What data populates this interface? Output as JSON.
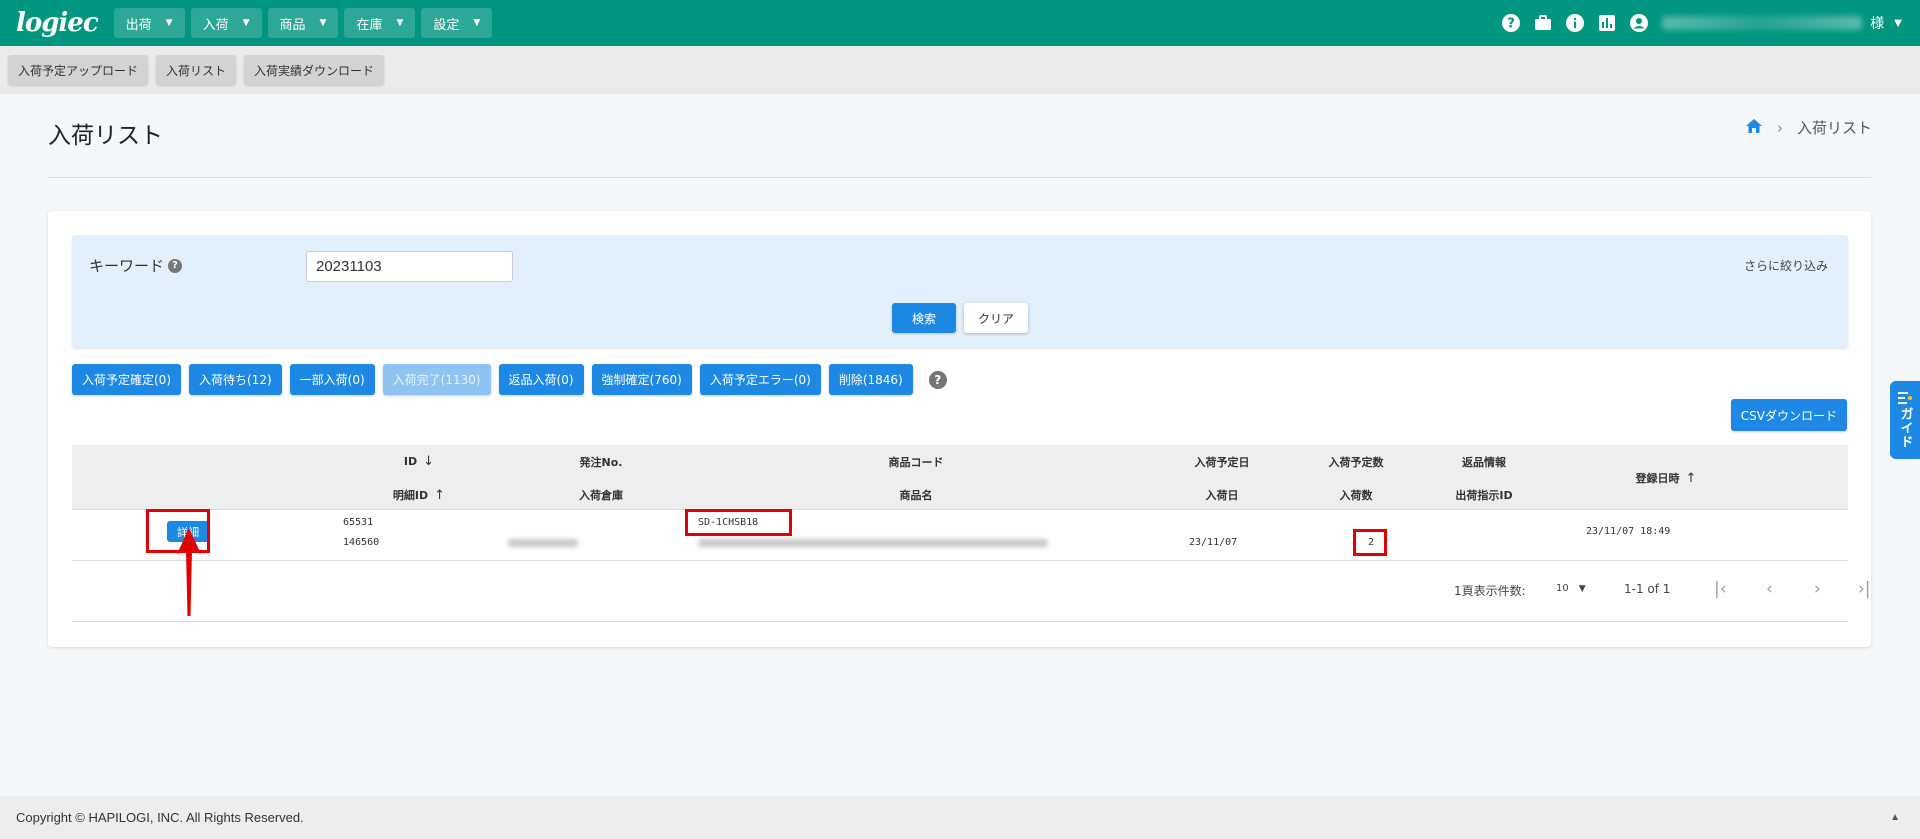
{
  "topbar": {
    "logo": "logiec",
    "logo_sub": "",
    "nav": [
      {
        "label": "出荷"
      },
      {
        "label": "入荷"
      },
      {
        "label": "商品"
      },
      {
        "label": "在庫"
      },
      {
        "label": "設定"
      }
    ],
    "user_suffix": "様",
    "icons": [
      "help-icon",
      "briefcase-icon",
      "info-icon",
      "chart-icon",
      "account-icon"
    ],
    "color": "#00957f"
  },
  "subbar": {
    "buttons": [
      {
        "label": "入荷予定アップロード"
      },
      {
        "label": "入荷リスト"
      },
      {
        "label": "入荷実績ダウンロード"
      }
    ]
  },
  "page": {
    "title": "入荷リスト",
    "breadcrumb_current": "入荷リスト"
  },
  "search": {
    "keyword_label": "キーワード",
    "keyword_value": "20231103",
    "narrow_label": "さらに絞り込み",
    "search_label": "検索",
    "clear_label": "クリア"
  },
  "filters": [
    {
      "label": "入荷予定確定(0)",
      "disabled": false
    },
    {
      "label": "入荷待ち(12)",
      "disabled": false
    },
    {
      "label": "一部入荷(0)",
      "disabled": false
    },
    {
      "label": "入荷完了(1130)",
      "disabled": true
    },
    {
      "label": "返品入荷(0)",
      "disabled": false
    },
    {
      "label": "強制確定(760)",
      "disabled": false
    },
    {
      "label": "入荷予定エラー(0)",
      "disabled": false
    },
    {
      "label": "削除(1846)",
      "disabled": false
    }
  ],
  "csv_label": "CSVダウンロード",
  "table": {
    "headers": {
      "id": "ID",
      "detail_id": "明細ID",
      "order_no": "発注No.",
      "warehouse": "入荷倉庫",
      "product_code": "商品コード",
      "product_name": "商品名",
      "scheduled_date": "入荷予定日",
      "arrival_date": "入荷日",
      "scheduled_qty": "入荷予定数",
      "arrival_qty": "入荷数",
      "return_info": "返品情報",
      "shipping_id": "出荷指示ID",
      "registered_at": "登録日時"
    },
    "row": {
      "detail_button": "詳細",
      "id": "65531",
      "detail_id": "146560",
      "product_code": "SD-1CHSB18",
      "arrival_date": "23/11/07",
      "arrival_qty": "2",
      "registered_at": "23/11/07 18:49"
    }
  },
  "pagination": {
    "per_page_label": "1頁表示件数:",
    "per_page_value": "10",
    "range": "1-1 of 1"
  },
  "guide_label": "ガイド",
  "footer": "Copyright © HAPILOGI, INC. All Rights Reserved.",
  "colors": {
    "accent": "#1e88e5",
    "highlight": "#e00000"
  }
}
